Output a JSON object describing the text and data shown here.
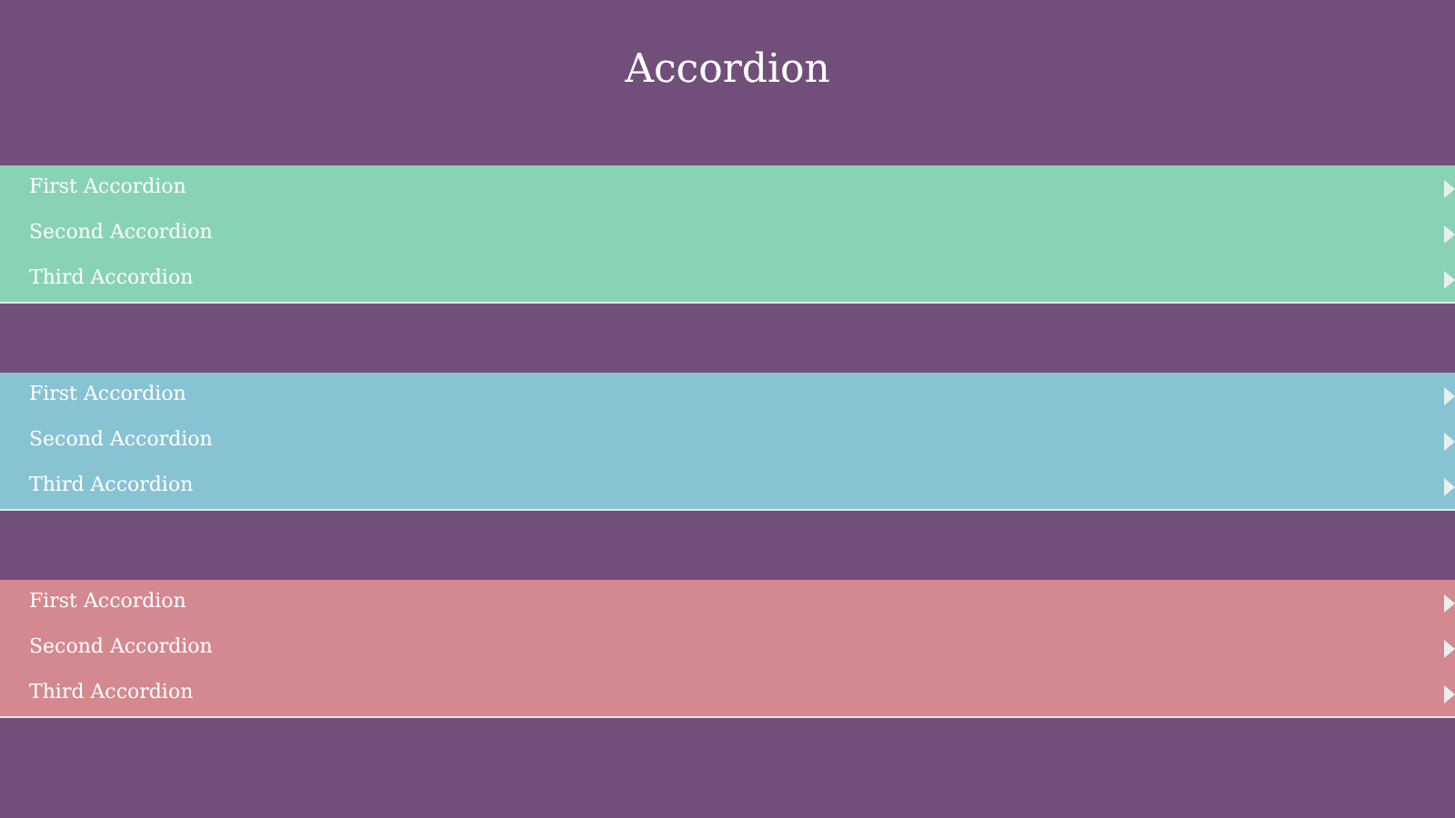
{
  "title": "Accordion",
  "accordions": [
    {
      "color": "#88d3b6",
      "items": [
        {
          "label": "First Accordion",
          "expanded": false
        },
        {
          "label": "Second Accordion",
          "expanded": false
        },
        {
          "label": "Third Accordion",
          "expanded": false
        }
      ]
    },
    {
      "color": "#88c3d4",
      "items": [
        {
          "label": "First Accordion",
          "expanded": false
        },
        {
          "label": "Second Accordion",
          "expanded": false
        },
        {
          "label": "Third Accordion",
          "expanded": false
        }
      ]
    },
    {
      "color": "#d4888f",
      "items": [
        {
          "label": "First Accordion",
          "expanded": false
        },
        {
          "label": "Second Accordion",
          "expanded": false
        },
        {
          "label": "Third Accordion",
          "expanded": false
        }
      ]
    }
  ]
}
